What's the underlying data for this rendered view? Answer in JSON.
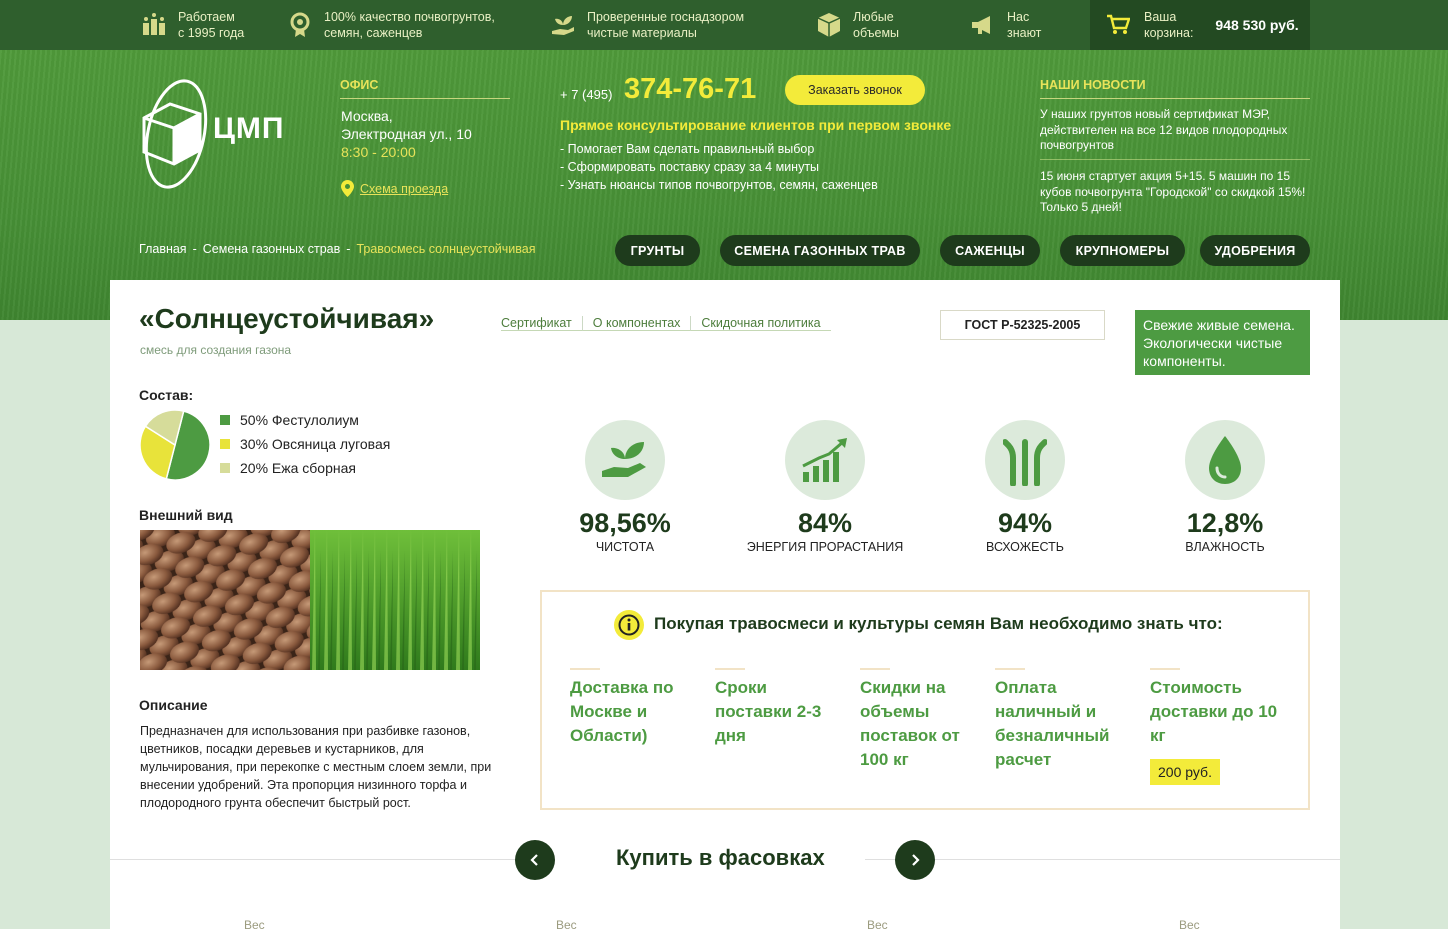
{
  "topbar": {
    "items": [
      {
        "line1": "Работаем",
        "line2": "с 1995 года",
        "icon": "buildings-icon"
      },
      {
        "line1": "100% качество почвогрунтов,",
        "line2": "семян, саженцев",
        "icon": "award-icon"
      },
      {
        "line1": "Проверенные госнадзором",
        "line2": "чистые материалы",
        "icon": "plant-hand-icon"
      },
      {
        "line1": "Любые",
        "line2": "объемы",
        "icon": "box-icon"
      },
      {
        "line1": "Нас",
        "line2": "знают",
        "icon": "megaphone-icon"
      }
    ],
    "cart": {
      "line1": "Ваша",
      "line2": "корзина:",
      "sum": "948 530 руб."
    }
  },
  "header": {
    "logo_text": "ЦМП",
    "office": {
      "heading": "ОФИС",
      "city": "Москва,",
      "address": "Электродная ул., 10",
      "hours": "8:30 - 20:00",
      "map_link": "Схема проезда"
    },
    "phone": {
      "prefix": "+ 7 (495)",
      "number": "374-76-71",
      "callback": "Заказать звонок"
    },
    "consult": {
      "title": "Прямое консультирование клиентов при первом звонке",
      "bullets": [
        "- Помогает Вам сделать правильный выбор",
        "- Сформировать поставку сразу за 4 минуты",
        "- Узнать нюансы типов  почвогрунтов, семян, саженцев"
      ]
    },
    "news": {
      "heading": "НАШИ НОВОСТИ",
      "items": [
        "У наших грунтов новый сертификат МЭР, действителен на все 12 видов плодородных почвогрунтов",
        "15 июня стартует акция 5+15. 5 машин по 15 кубов почвогрунта \"Городской\" со скидкой 15%! Только 5 дней!"
      ]
    }
  },
  "breadcrumbs": {
    "items": [
      "Главная",
      "Семена газонных страв",
      "Травосмесь солнцеустойчивая"
    ],
    "sep": "-"
  },
  "nav": [
    "ГРУНТЫ",
    "СЕМЕНА ГАЗОННЫХ ТРАВ",
    "САЖЕНЦЫ",
    "КРУПНОМЕРЫ",
    "УДОБРЕНИЯ"
  ],
  "product": {
    "title": "«Солнцеустойчивая»",
    "subtitle": "смесь для создания газона",
    "tabs": [
      "Сертификат",
      "О компонентах",
      "Скидочная политика"
    ],
    "gost": "ГОСТ Р-52325-2005",
    "fresh": "Свежие живые семена. Экологически чистые компоненты.",
    "composition_heading": "Состав:",
    "appearance_heading": "Внешний вид",
    "description_heading": "Описание",
    "description": "Предназначен для использования при разбивке газонов, цветников, посадки деревьев и кустарников, для мульчирования, при перекопке с местным слоем земли, при внесении удобрений. Эта пропорция низинного торфа и плодородного грунта обеспечит быстрый рост."
  },
  "chart_data": {
    "type": "pie",
    "slices": [
      {
        "label": "50% Фестулолиум",
        "value": 50,
        "color": "#4d9b42"
      },
      {
        "label": "30% Овсяница луговая",
        "value": 30,
        "color": "#e8e33a"
      },
      {
        "label": "20% Ежа сборная",
        "value": 20,
        "color": "#d6dc9a"
      }
    ]
  },
  "stats": [
    {
      "value": "98,56%",
      "label": "ЧИСТОТА",
      "icon": "leaf-hand-icon"
    },
    {
      "value": "84%",
      "label": "ЭНЕРГИЯ ПРОРАСТАНИЯ",
      "icon": "growth-chart-icon"
    },
    {
      "value": "94%",
      "label": "ВСХОЖЕСТЬ",
      "icon": "sprout-icon"
    },
    {
      "value": "12,8%",
      "label": "ВЛАЖНОСТЬ",
      "icon": "water-drop-icon"
    }
  ],
  "info": {
    "title": "Покупая травосмеси и культуры семян Вам необходимо знать что:",
    "conditions": [
      "Доставка по Москве и Области)",
      "Сроки поставки 2-3 дня",
      "Скидки на объемы поставок от 100 кг",
      "Оплата наличный и безналичный расчет",
      "Стоимость доставки до 10 кг"
    ],
    "price": "200 руб."
  },
  "buy": {
    "title": "Купить в фасовках",
    "item_label": "Вес"
  },
  "colors": {
    "dark_green": "#1e3b1c",
    "green": "#4d9b42",
    "yellow": "#f3eb3a",
    "hero": "#4f9a3a"
  }
}
